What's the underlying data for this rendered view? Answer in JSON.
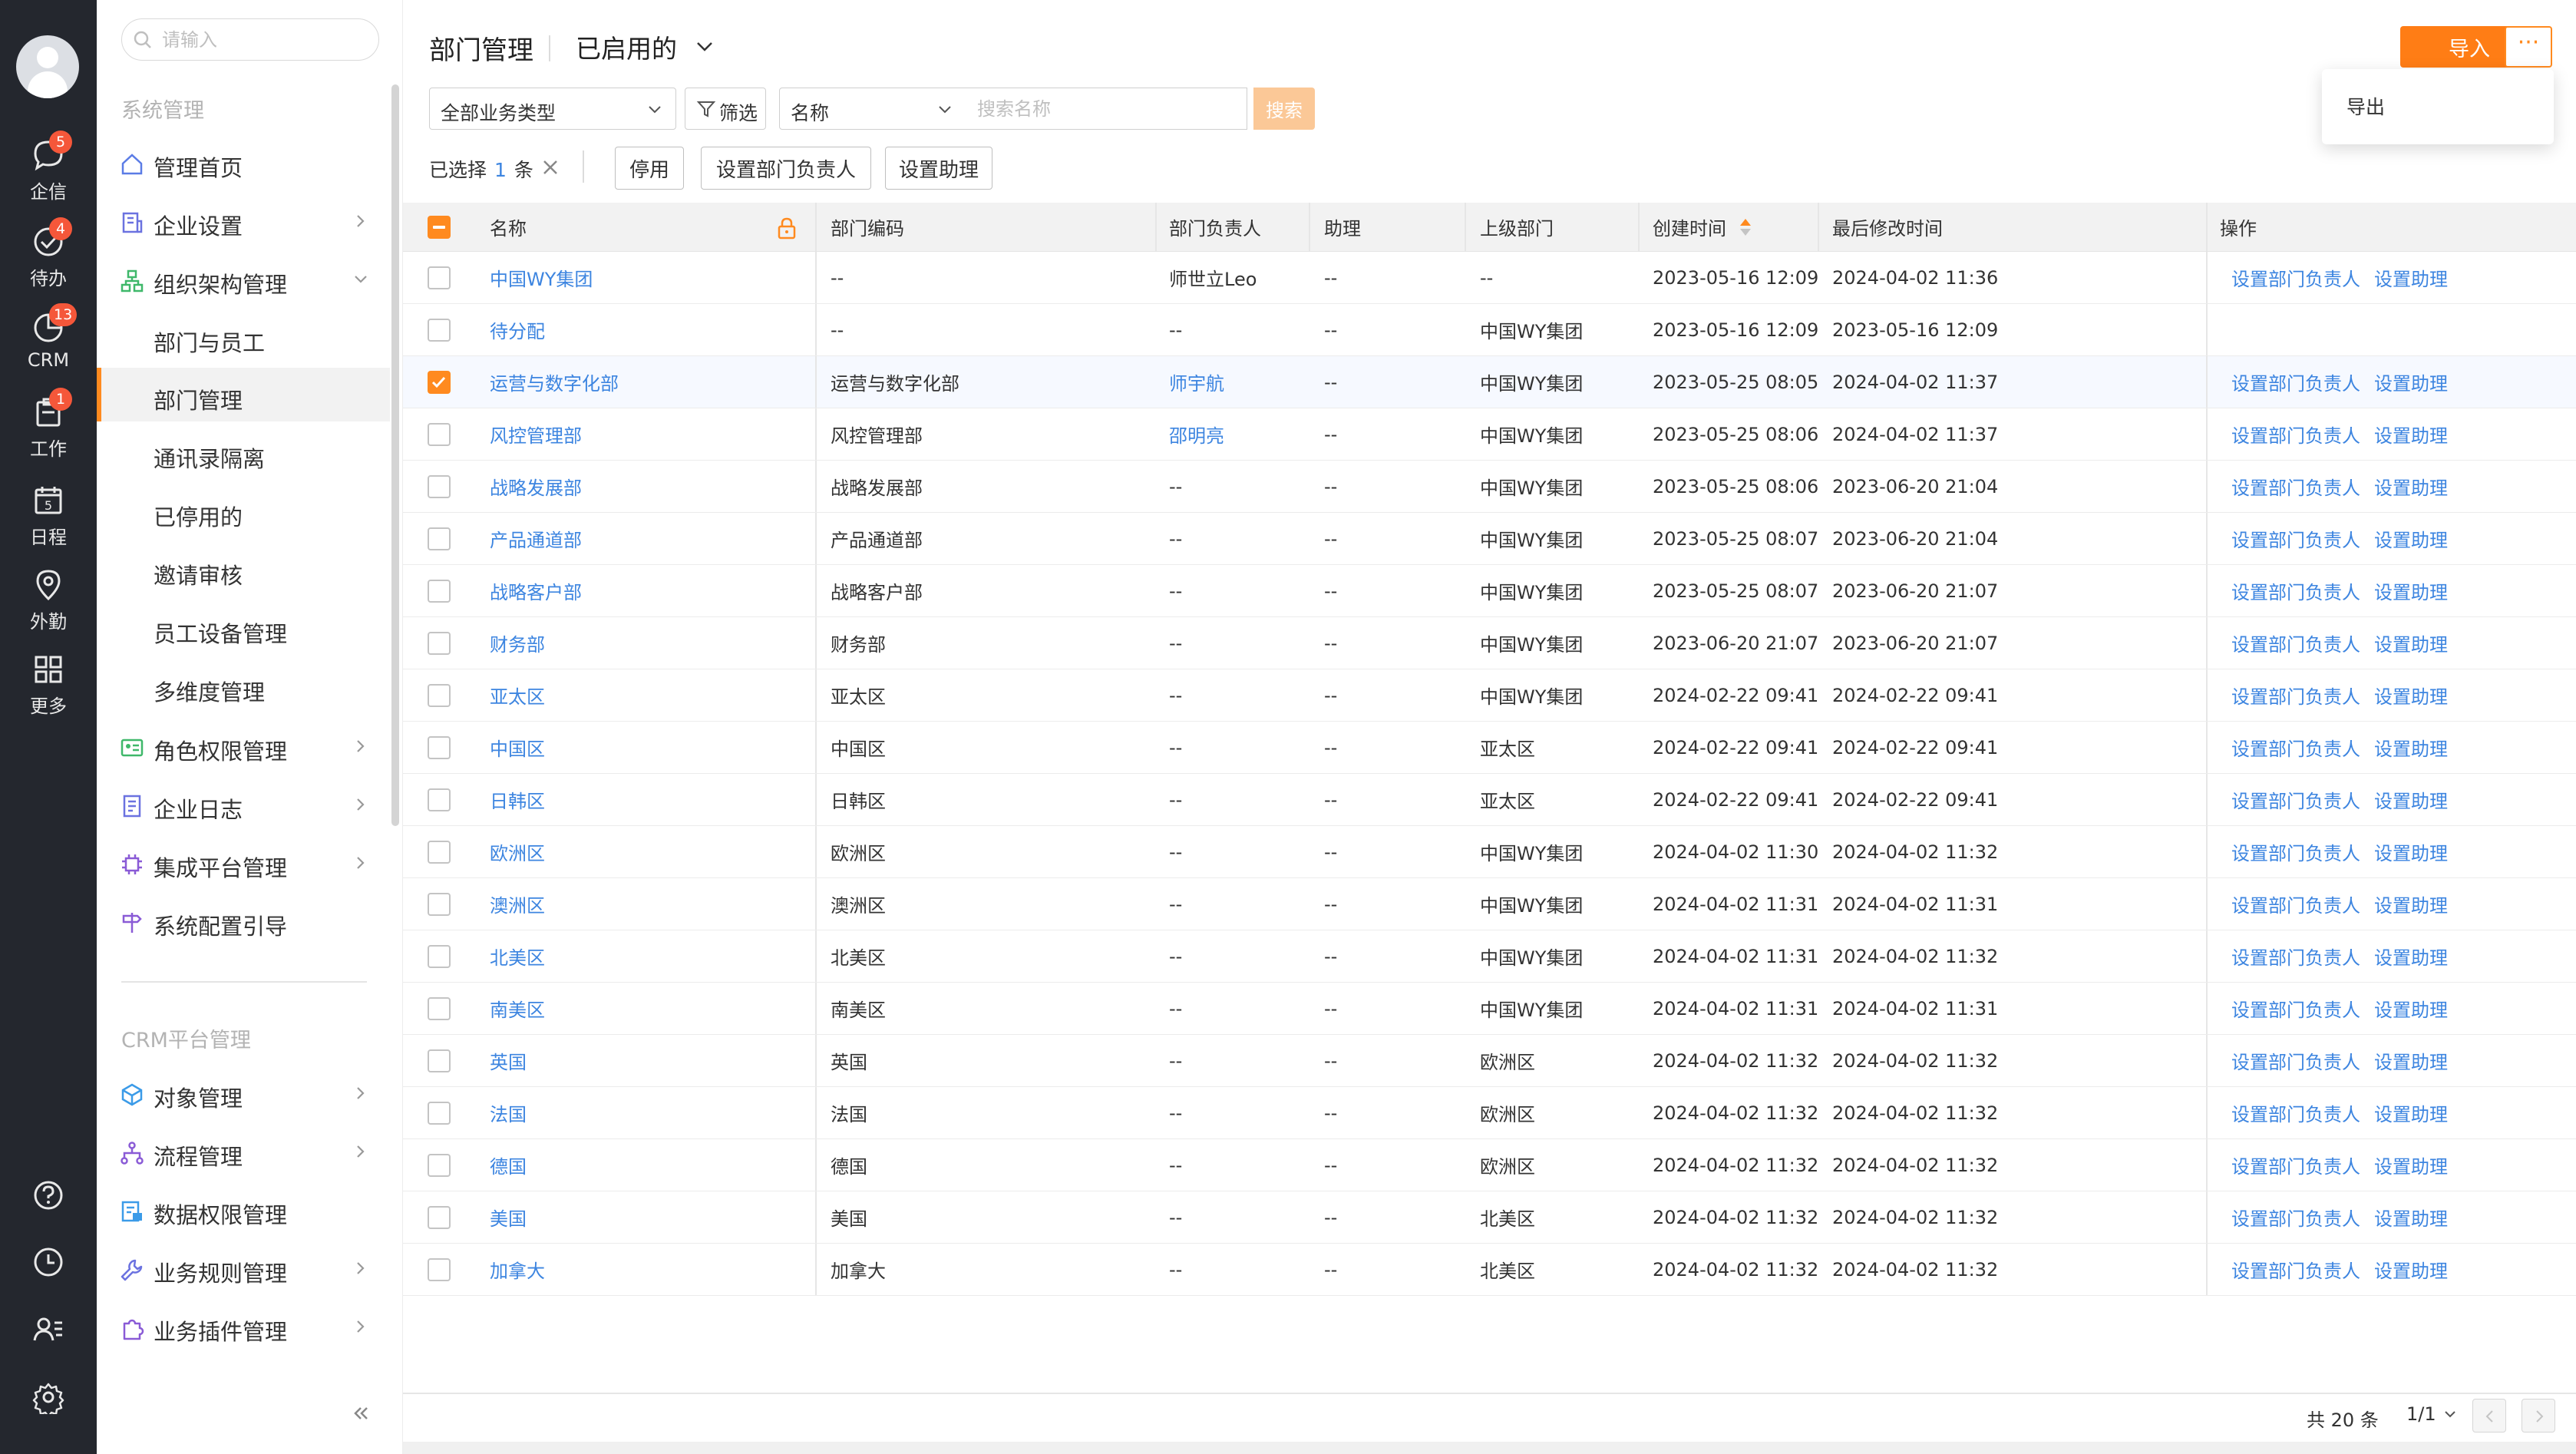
{
  "rail": {
    "items": [
      {
        "label": "企信",
        "badge": "5",
        "icon": "chat-bubble-icon"
      },
      {
        "label": "待办",
        "badge": "4",
        "icon": "check-circle-icon"
      },
      {
        "label": "CRM",
        "badge": "13",
        "icon": "pie-chart-icon"
      },
      {
        "label": "工作",
        "badge": "1",
        "icon": "clipboard-icon"
      },
      {
        "label": "日程",
        "badge": "",
        "icon": "calendar-icon"
      },
      {
        "label": "外勤",
        "badge": "",
        "icon": "location-pin-icon"
      },
      {
        "label": "更多",
        "badge": "",
        "icon": "grid-icon"
      }
    ],
    "bottom_icons": [
      "help-icon",
      "clock-icon",
      "contacts-icon",
      "settings-icon"
    ]
  },
  "sidebar": {
    "search_placeholder": "请输入",
    "section1_title": "系统管理",
    "nav1": [
      {
        "label": "管理首页",
        "icon": "home-icon",
        "has_chevron": false
      },
      {
        "label": "企业设置",
        "icon": "building-icon",
        "has_chevron": true
      },
      {
        "label": "组织架构管理",
        "icon": "org-tree-icon",
        "has_chevron": true,
        "expanded": true
      }
    ],
    "sub_items": [
      {
        "label": "部门与员工",
        "active": false
      },
      {
        "label": "部门管理",
        "active": true
      },
      {
        "label": "通讯录隔离",
        "active": false
      },
      {
        "label": "已停用的",
        "active": false
      },
      {
        "label": "邀请审核",
        "active": false
      },
      {
        "label": "员工设备管理",
        "active": false
      },
      {
        "label": "多维度管理",
        "active": false
      }
    ],
    "nav2": [
      {
        "label": "角色权限管理",
        "icon": "id-card-icon",
        "has_chevron": true
      },
      {
        "label": "企业日志",
        "icon": "document-icon",
        "has_chevron": true
      },
      {
        "label": "集成平台管理",
        "icon": "chip-icon",
        "has_chevron": true
      },
      {
        "label": "系统配置引导",
        "icon": "signpost-icon",
        "has_chevron": false
      }
    ],
    "section2_title": "CRM平台管理",
    "nav3": [
      {
        "label": "对象管理",
        "icon": "cube-icon",
        "has_chevron": true
      },
      {
        "label": "流程管理",
        "icon": "flow-icon",
        "has_chevron": true
      },
      {
        "label": "数据权限管理",
        "icon": "data-lock-icon",
        "has_chevron": false
      },
      {
        "label": "业务规则管理",
        "icon": "wrench-icon",
        "has_chevron": true
      },
      {
        "label": "业务插件管理",
        "icon": "plugin-icon",
        "has_chevron": true
      }
    ],
    "collapse_symbol": "«"
  },
  "header": {
    "title": "部门管理",
    "view_label": "已启用的",
    "import_label": "导入",
    "more_label": "···",
    "more_menu": [
      "导出"
    ]
  },
  "filters": {
    "business_type": "全部业务类型",
    "filter_label": "筛选",
    "field": "名称",
    "search_placeholder": "搜索名称",
    "search_button": "搜索"
  },
  "selection": {
    "prefix": "已选择",
    "count": "1",
    "suffix": "条",
    "actions": [
      "停用",
      "设置部门负责人",
      "设置助理"
    ]
  },
  "table": {
    "columns": [
      "名称",
      "部门编码",
      "部门负责人",
      "助理",
      "上级部门",
      "创建时间",
      "最后修改时间",
      "操作"
    ],
    "op_labels": [
      "设置部门负责人",
      "设置助理"
    ],
    "rows": [
      {
        "name": "中国WY集团",
        "code": "--",
        "head": "师世立Leo",
        "head_link": false,
        "assistant": "--",
        "parent": "--",
        "created": "2023-05-16 12:09",
        "modified": "2024-04-02 11:36",
        "ops": true,
        "checked": false
      },
      {
        "name": "待分配",
        "code": "--",
        "head": "--",
        "head_link": false,
        "assistant": "--",
        "parent": "中国WY集团",
        "created": "2023-05-16 12:09",
        "modified": "2023-05-16 12:09",
        "ops": false,
        "checked": false
      },
      {
        "name": "运营与数字化部",
        "code": "运营与数字化部",
        "head": "师宇航",
        "head_link": true,
        "assistant": "--",
        "parent": "中国WY集团",
        "created": "2023-05-25 08:05",
        "modified": "2024-04-02 11:37",
        "ops": true,
        "checked": true
      },
      {
        "name": "风控管理部",
        "code": "风控管理部",
        "head": "邵明亮",
        "head_link": true,
        "assistant": "--",
        "parent": "中国WY集团",
        "created": "2023-05-25 08:06",
        "modified": "2024-04-02 11:37",
        "ops": true,
        "checked": false
      },
      {
        "name": "战略发展部",
        "code": "战略发展部",
        "head": "--",
        "head_link": false,
        "assistant": "--",
        "parent": "中国WY集团",
        "created": "2023-05-25 08:06",
        "modified": "2023-06-20 21:04",
        "ops": true,
        "checked": false
      },
      {
        "name": "产品通道部",
        "code": "产品通道部",
        "head": "--",
        "head_link": false,
        "assistant": "--",
        "parent": "中国WY集团",
        "created": "2023-05-25 08:07",
        "modified": "2023-06-20 21:04",
        "ops": true,
        "checked": false
      },
      {
        "name": "战略客户部",
        "code": "战略客户部",
        "head": "--",
        "head_link": false,
        "assistant": "--",
        "parent": "中国WY集团",
        "created": "2023-05-25 08:07",
        "modified": "2023-06-20 21:07",
        "ops": true,
        "checked": false
      },
      {
        "name": "财务部",
        "code": "财务部",
        "head": "--",
        "head_link": false,
        "assistant": "--",
        "parent": "中国WY集团",
        "created": "2023-06-20 21:07",
        "modified": "2023-06-20 21:07",
        "ops": true,
        "checked": false
      },
      {
        "name": "亚太区",
        "code": "亚太区",
        "head": "--",
        "head_link": false,
        "assistant": "--",
        "parent": "中国WY集团",
        "created": "2024-02-22 09:41",
        "modified": "2024-02-22 09:41",
        "ops": true,
        "checked": false
      },
      {
        "name": "中国区",
        "code": "中国区",
        "head": "--",
        "head_link": false,
        "assistant": "--",
        "parent": "亚太区",
        "created": "2024-02-22 09:41",
        "modified": "2024-02-22 09:41",
        "ops": true,
        "checked": false
      },
      {
        "name": "日韩区",
        "code": "日韩区",
        "head": "--",
        "head_link": false,
        "assistant": "--",
        "parent": "亚太区",
        "created": "2024-02-22 09:41",
        "modified": "2024-02-22 09:41",
        "ops": true,
        "checked": false
      },
      {
        "name": "欧洲区",
        "code": "欧洲区",
        "head": "--",
        "head_link": false,
        "assistant": "--",
        "parent": "中国WY集团",
        "created": "2024-04-02 11:30",
        "modified": "2024-04-02 11:32",
        "ops": true,
        "checked": false
      },
      {
        "name": "澳洲区",
        "code": "澳洲区",
        "head": "--",
        "head_link": false,
        "assistant": "--",
        "parent": "中国WY集团",
        "created": "2024-04-02 11:31",
        "modified": "2024-04-02 11:31",
        "ops": true,
        "checked": false
      },
      {
        "name": "北美区",
        "code": "北美区",
        "head": "--",
        "head_link": false,
        "assistant": "--",
        "parent": "中国WY集团",
        "created": "2024-04-02 11:31",
        "modified": "2024-04-02 11:32",
        "ops": true,
        "checked": false
      },
      {
        "name": "南美区",
        "code": "南美区",
        "head": "--",
        "head_link": false,
        "assistant": "--",
        "parent": "中国WY集团",
        "created": "2024-04-02 11:31",
        "modified": "2024-04-02 11:31",
        "ops": true,
        "checked": false
      },
      {
        "name": "英国",
        "code": "英国",
        "head": "--",
        "head_link": false,
        "assistant": "--",
        "parent": "欧洲区",
        "created": "2024-04-02 11:32",
        "modified": "2024-04-02 11:32",
        "ops": true,
        "checked": false
      },
      {
        "name": "法国",
        "code": "法国",
        "head": "--",
        "head_link": false,
        "assistant": "--",
        "parent": "欧洲区",
        "created": "2024-04-02 11:32",
        "modified": "2024-04-02 11:32",
        "ops": true,
        "checked": false
      },
      {
        "name": "德国",
        "code": "德国",
        "head": "--",
        "head_link": false,
        "assistant": "--",
        "parent": "欧洲区",
        "created": "2024-04-02 11:32",
        "modified": "2024-04-02 11:32",
        "ops": true,
        "checked": false
      },
      {
        "name": "美国",
        "code": "美国",
        "head": "--",
        "head_link": false,
        "assistant": "--",
        "parent": "北美区",
        "created": "2024-04-02 11:32",
        "modified": "2024-04-02 11:32",
        "ops": true,
        "checked": false
      },
      {
        "name": "加拿大",
        "code": "加拿大",
        "head": "--",
        "head_link": false,
        "assistant": "--",
        "parent": "北美区",
        "created": "2024-04-02 11:32",
        "modified": "2024-04-02 11:32",
        "ops": true,
        "checked": false
      }
    ]
  },
  "pager": {
    "total": "共 20 条",
    "page": "1/1"
  },
  "colors": {
    "accent": "#ff7d15",
    "link": "#3d85e0",
    "rail_bg": "#24272e",
    "badge": "#f5573a"
  }
}
